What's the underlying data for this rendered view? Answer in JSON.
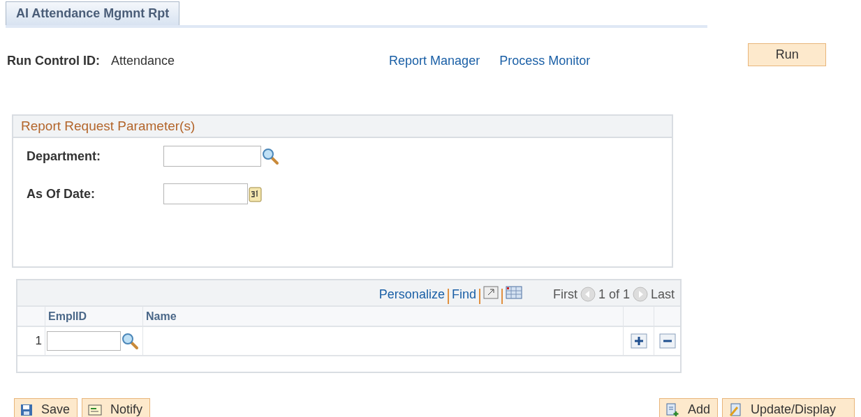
{
  "tabs": [
    {
      "label": "AI Attendance Mgmnt Rpt",
      "selected": true
    }
  ],
  "run_control": {
    "label": "Run Control ID:",
    "value": "Attendance"
  },
  "links": [
    "Report Manager",
    "Process Monitor"
  ],
  "run_button": "Run",
  "parameters": {
    "title": "Report Request Parameter(s)",
    "fields": [
      {
        "label": "Department:",
        "kind": "lookup"
      },
      {
        "label": "As Of Date:",
        "kind": "date"
      }
    ]
  },
  "grid": {
    "toolbar": {
      "personalize": "Personalize",
      "find": "Find",
      "first": "First",
      "count": "1 of 1",
      "last": "Last"
    },
    "columns": [
      "EmplID",
      "Name"
    ],
    "rows": [
      {
        "number": "1"
      }
    ]
  },
  "buttons": [
    {
      "label": "Save",
      "kind": "save"
    },
    {
      "label": "Notify",
      "kind": "notify"
    },
    {
      "label": "Add",
      "kind": "add"
    },
    {
      "label": "Update/Display",
      "kind": "update"
    }
  ]
}
